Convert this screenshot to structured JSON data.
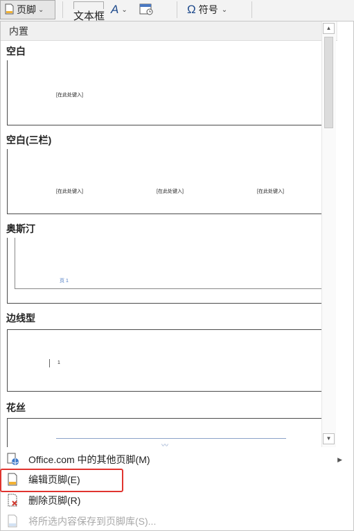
{
  "ribbon": {
    "footer_label": "页脚",
    "textbox_label": "文本框",
    "symbol_label": "符号",
    "symbol_glyph": "Ω",
    "wordart_glyph": "A"
  },
  "gallery": {
    "section_header": "内置",
    "items": [
      {
        "title": "空白",
        "placeholders": [
          "[在此处键入]"
        ]
      },
      {
        "title": "空白(三栏)",
        "placeholders": [
          "[在此处键入]",
          "[在此处键入]",
          "[在此处键入]"
        ]
      },
      {
        "title": "奥斯汀",
        "placeholders": [
          "页 1"
        ]
      },
      {
        "title": "边线型",
        "placeholders": [
          "1"
        ]
      },
      {
        "title": "花丝"
      }
    ]
  },
  "menu": {
    "items": [
      {
        "label": "Office.com 中的其他页脚(M)",
        "icon": "office-online-icon",
        "has_submenu": true,
        "enabled": true
      },
      {
        "label": "编辑页脚(E)",
        "icon": "edit-footer-icon",
        "enabled": true
      },
      {
        "label": "删除页脚(R)",
        "icon": "remove-footer-icon",
        "enabled": true,
        "highlighted": true
      },
      {
        "label": "将所选内容保存到页脚库(S)...",
        "icon": "save-to-gallery-icon",
        "enabled": false
      }
    ]
  },
  "colors": {
    "accent_blue": "#1e4a8c",
    "highlight_red": "#e0342f",
    "disabled_text": "#a8a8a8"
  }
}
